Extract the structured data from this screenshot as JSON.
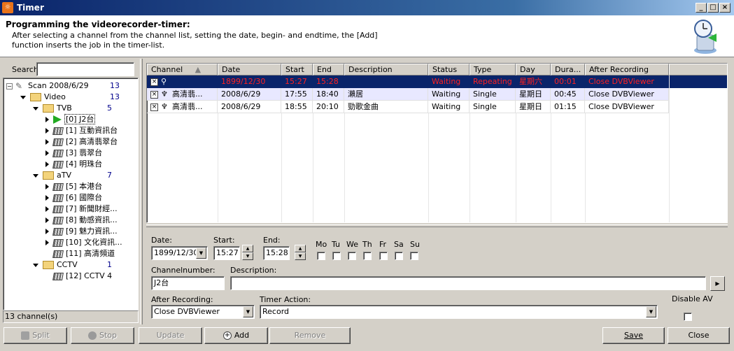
{
  "window": {
    "title": "Timer",
    "controls": {
      "minimize": "_",
      "maximize": "□",
      "close": "×"
    }
  },
  "header": {
    "title": "Programming the videorecorder-timer:",
    "description": "After selecting a channel from the channel list, setting the date, begin- and endtime, the [Add] function inserts the job in the timer-list."
  },
  "sidebar": {
    "search_label": "Search",
    "search_value": "",
    "tree": {
      "root": {
        "label": "Scan 2008/6/29",
        "count": "13"
      },
      "video": {
        "label": "Video",
        "count": "13"
      },
      "tvb": {
        "label": "TVB",
        "count": "5"
      },
      "atv": {
        "label": "aTV",
        "count": "7"
      },
      "cctv": {
        "label": "CCTV",
        "count": "1"
      },
      "channels": [
        "[0]  J2台",
        "[1]  互動資訊台",
        "[2]  高清翡翠台",
        "[3]  翡翠台",
        "[4]  明珠台",
        "[5]  本港台",
        "[6]  國際台",
        "[7]  新聞財經...",
        "[8]  動感資訊...",
        "[9]  魅力資訊...",
        "[10]  文化資訊...",
        "[11]  高清頻道",
        "[12]  CCTV 4"
      ]
    },
    "status": "13 channel(s)"
  },
  "table": {
    "columns": [
      "Channel",
      "Date",
      "Start",
      "End",
      "Description",
      "Status",
      "Type",
      "Day",
      "Dura...",
      "After Recording"
    ],
    "sort_indicator": "▲",
    "rows": [
      {
        "checked": "×",
        "channel": "",
        "date": "1899/12/30",
        "start": "15:27",
        "end": "15:28",
        "description": "",
        "status": "Waiting",
        "type": "Repeating",
        "day": "星期六",
        "duration": "00:01",
        "after": "Close DVBViewer"
      },
      {
        "checked": "×",
        "channel": "高清翡...",
        "date": "2008/6/29",
        "start": "17:55",
        "end": "18:40",
        "description": "瀨居",
        "status": "Waiting",
        "type": "Single",
        "day": "星期日",
        "duration": "00:45",
        "after": "Close DVBViewer"
      },
      {
        "checked": "×",
        "channel": "高清翡...",
        "date": "2008/6/29",
        "start": "18:55",
        "end": "20:10",
        "description": "勁歌金曲",
        "status": "Waiting",
        "type": "Single",
        "day": "星期日",
        "duration": "01:15",
        "after": "Close DVBViewer"
      }
    ]
  },
  "form": {
    "date_label": "Date:",
    "date_value": "1899/12/30",
    "start_label": "Start:",
    "start_value": "15:27",
    "end_label": "End:",
    "end_value": "15:28",
    "days": [
      "Mo",
      "Tu",
      "We",
      "Th",
      "Fr",
      "Sa",
      "Su"
    ],
    "channelnumber_label": "Channelnumber:",
    "channelnumber_value": "J2台",
    "description_label": "Description:",
    "description_value": "",
    "after_recording_label": "After Recording:",
    "after_recording_value": "Close DVBViewer",
    "timer_action_label": "Timer Action:",
    "timer_action_value": "Record",
    "disable_av_label": "Disable AV"
  },
  "buttons": {
    "split": "Split",
    "stop": "Stop",
    "update": "Update",
    "add": "Add",
    "remove": "Remove",
    "save": "Save",
    "close": "Close"
  }
}
